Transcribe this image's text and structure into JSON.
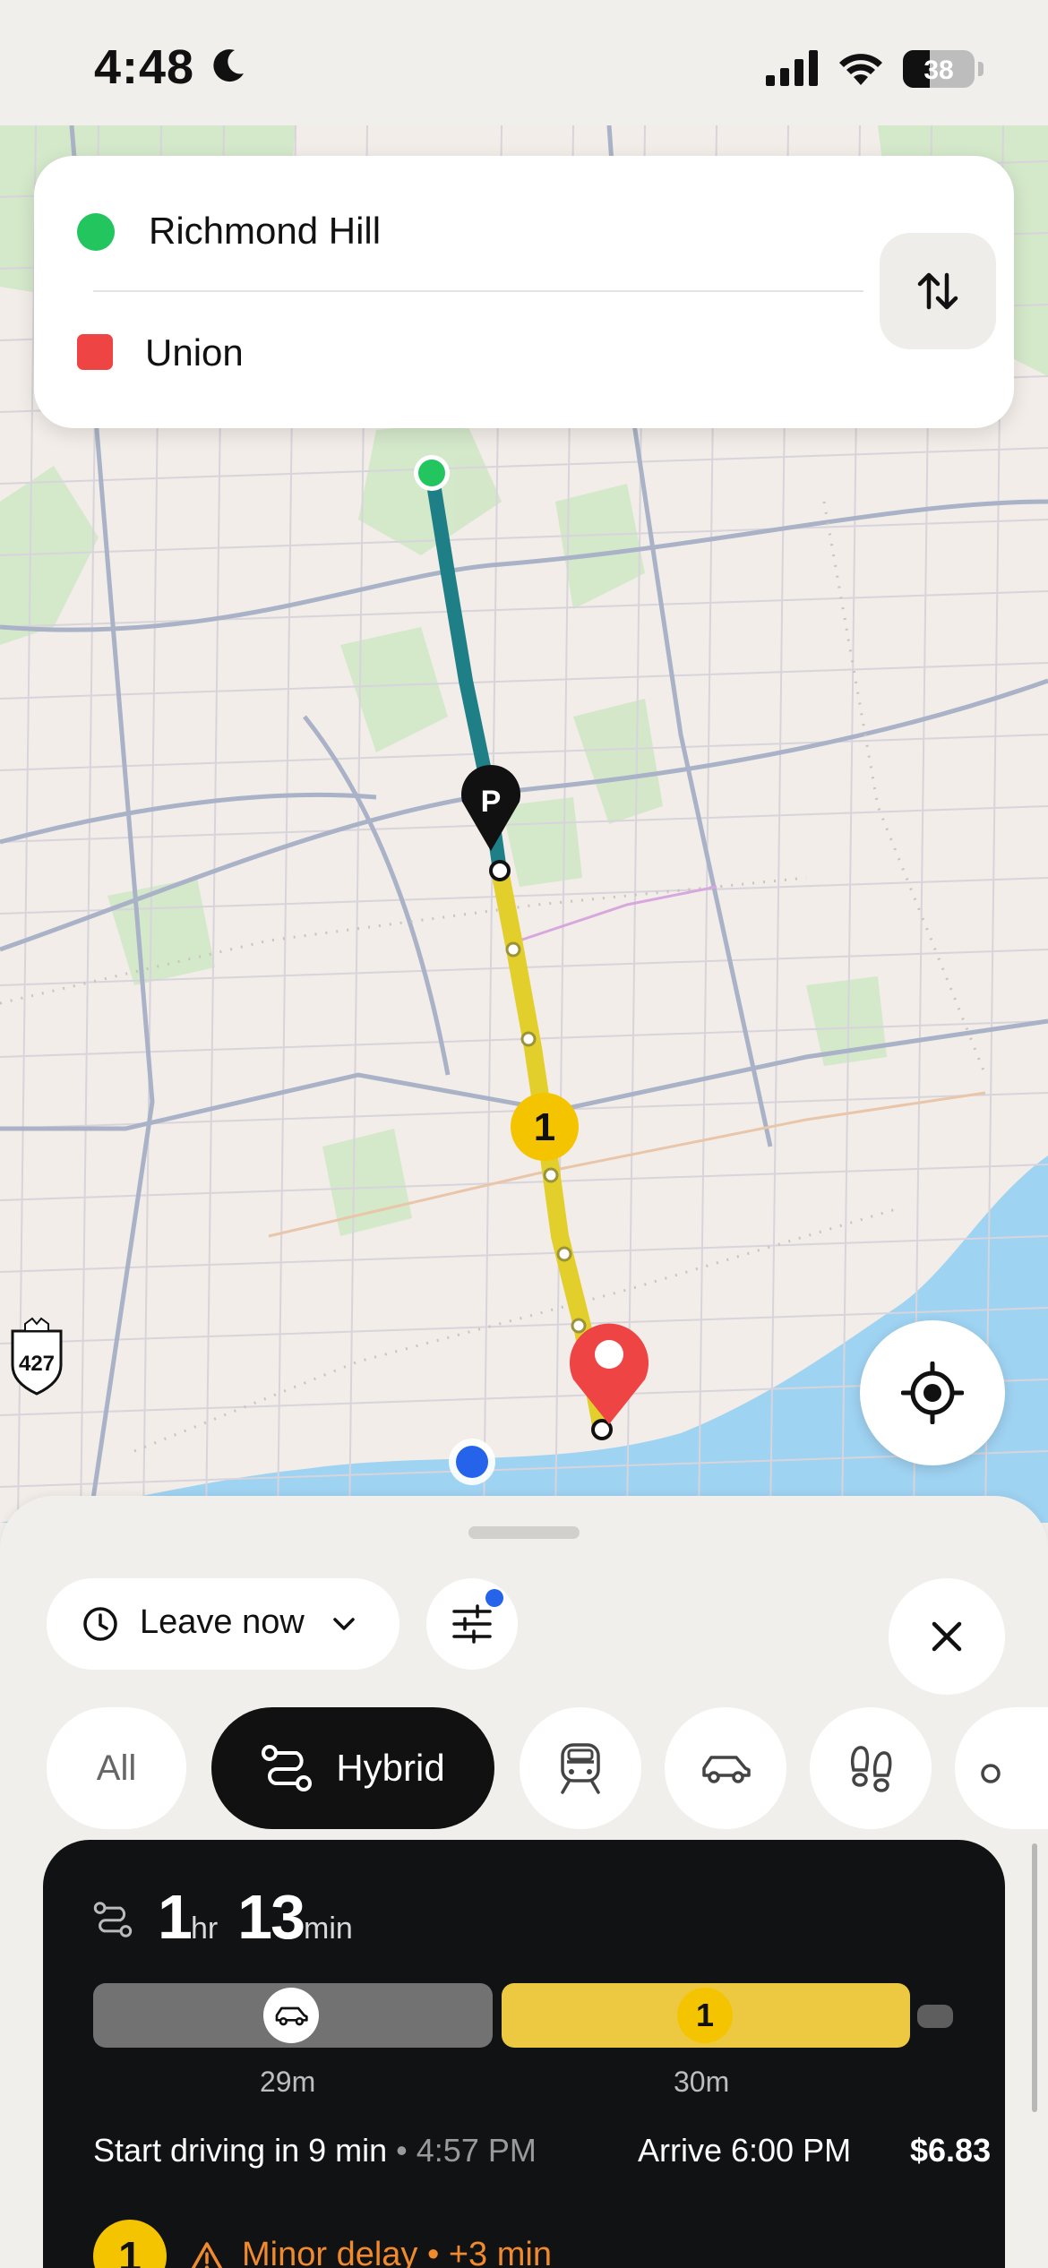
{
  "status_bar": {
    "time": "4:48",
    "battery": "38"
  },
  "route": {
    "origin": "Richmond Hill",
    "destination": "Union"
  },
  "map": {
    "highway_shield": "427",
    "transit_marker_label": "1",
    "parking_marker_label": "P"
  },
  "controls": {
    "leave_label": "Leave now",
    "filter_has_badge": true
  },
  "modes": [
    {
      "label": "All",
      "selected": false
    },
    {
      "label": "Hybrid",
      "selected": true,
      "icon": "route-icon"
    },
    {
      "icon": "train-icon",
      "selected": false
    },
    {
      "icon": "car-icon",
      "selected": false
    },
    {
      "icon": "walk-icon",
      "selected": false
    },
    {
      "icon": "bike-icon",
      "selected": false
    }
  ],
  "trip": {
    "duration_hr": "1",
    "duration_hr_unit": "hr",
    "duration_min": "13",
    "duration_min_unit": "min",
    "segments": [
      {
        "type": "drive",
        "icon": "car-icon",
        "label": "29m",
        "share": 0.49
      },
      {
        "type": "transit",
        "line": "1",
        "label": "30m",
        "share": 0.5
      },
      {
        "type": "walk",
        "share": 0.01
      }
    ],
    "start_text": "Start driving in 9 min",
    "separator": "•",
    "start_time": "4:57 PM",
    "arrive_text": "Arrive 6:00 PM",
    "price": "$6.83",
    "delay_line": "1",
    "delay_text": "Minor delay • +3 min"
  },
  "colors": {
    "origin": "#22c55e",
    "destination": "#ef4444",
    "drive_route": "#1f7f86",
    "transit_route": "#e3cf2c",
    "line1": "#f5c400",
    "delay": "#f08a2c",
    "pin": "#ef4444"
  }
}
